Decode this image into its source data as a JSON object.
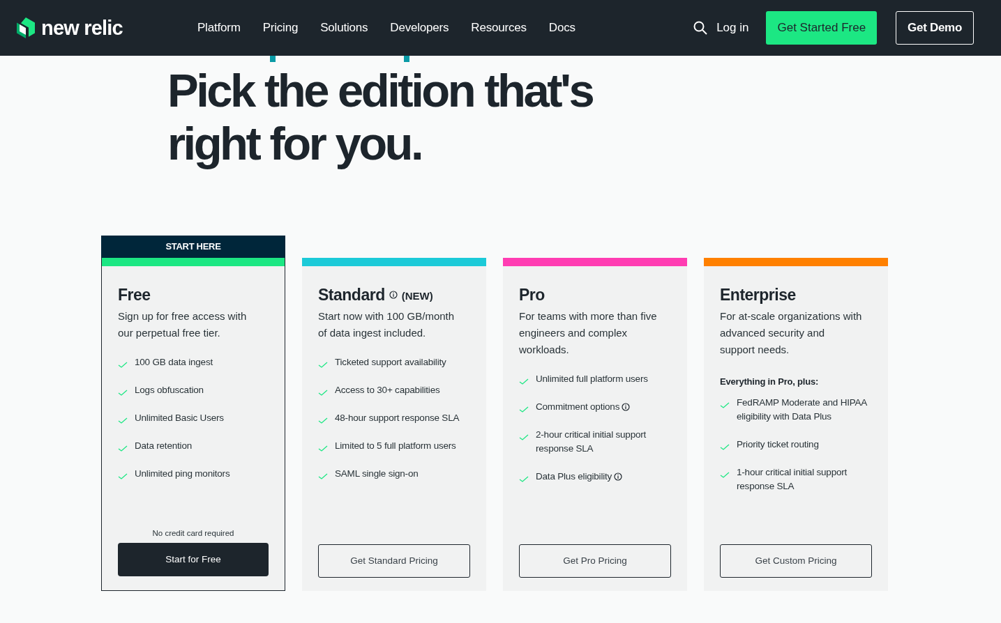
{
  "nav": {
    "logo": "new relic",
    "links": [
      "Platform",
      "Pricing",
      "Solutions",
      "Developers",
      "Resources",
      "Docs"
    ],
    "login": "Log in",
    "primary_button": "Get Started Free",
    "secondary_button": "Get Demo"
  },
  "heading": "Pick the edition that's right for you.",
  "plans": [
    {
      "badge": "START HERE",
      "color": "#1ce783",
      "highlighted": true,
      "title": "Free",
      "description": "Sign up for free access with our perpetual free tier.",
      "features": [
        {
          "text": "100 GB data ingest"
        },
        {
          "text": "Logs obfuscation"
        },
        {
          "text": "Unlimited Basic Users"
        },
        {
          "text": "Data retention"
        },
        {
          "text": "Unlimited ping monitors"
        }
      ],
      "note": "No credit card required",
      "button": {
        "label": "Start for Free",
        "kind": "primary"
      }
    },
    {
      "color": "#1ccad8",
      "highlighted": false,
      "title": "Standard",
      "title_info": true,
      "tag": "(NEW)",
      "description": "Start now with 100 GB/month of data ingest included.",
      "features": [
        {
          "text": "Ticketed support availability"
        },
        {
          "text": "Access to 30+ capabilities"
        },
        {
          "text": "48-hour support response SLA"
        },
        {
          "text": "Limited to 5 full platform users"
        },
        {
          "text": "SAML single sign-on"
        }
      ],
      "button": {
        "label": "Get Standard Pricing",
        "kind": "outline"
      }
    },
    {
      "color": "#ff3db2",
      "highlighted": false,
      "title": "Pro",
      "description": "For teams with more than five engineers and complex workloads.",
      "features": [
        {
          "text": "Unlimited full platform users"
        },
        {
          "text": "Commitment options",
          "info": true
        },
        {
          "text": "2-hour critical initial support response SLA"
        },
        {
          "text": "Data Plus eligibility",
          "info": true
        }
      ],
      "button": {
        "label": "Get Pro Pricing",
        "kind": "outline"
      }
    },
    {
      "color": "#ff8000",
      "highlighted": false,
      "title": "Enterprise",
      "description": "For at-scale organizations with advanced security and support needs.",
      "intro": "Everything in Pro, plus:",
      "features": [
        {
          "text": "FedRAMP Moderate and HIPAA eligibility with Data Plus"
        },
        {
          "text": "Priority ticket routing"
        },
        {
          "text": "1-hour critical initial support response SLA"
        }
      ],
      "button": {
        "label": "Get Custom Pricing",
        "kind": "outline"
      }
    }
  ]
}
